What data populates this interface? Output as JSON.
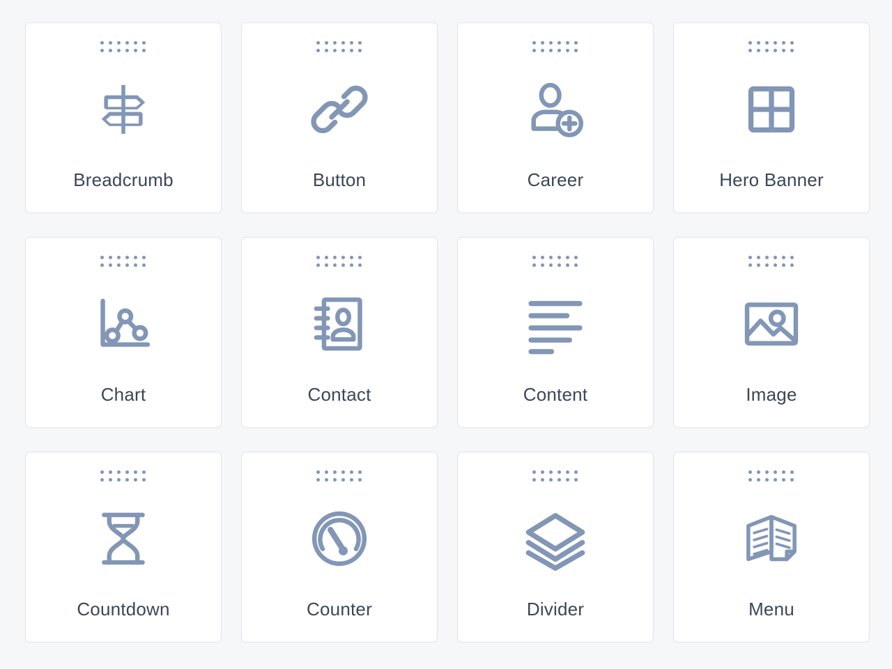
{
  "palette": {
    "drag_handle_dots": 12,
    "colors": {
      "background": "#f6f7f9",
      "card_background": "#ffffff",
      "card_border": "#dfe3ea",
      "icon": "#8296b6",
      "label_text": "#3b4657",
      "handle_dot": "#8296b6"
    },
    "widgets": [
      {
        "label": "Breadcrumb",
        "icon": "signpost-icon"
      },
      {
        "label": "Button",
        "icon": "link-chain-icon"
      },
      {
        "label": "Career",
        "icon": "user-plus-icon"
      },
      {
        "label": "Hero Banner",
        "icon": "grid-window-icon"
      },
      {
        "label": "Chart",
        "icon": "line-chart-icon"
      },
      {
        "label": "Contact",
        "icon": "address-book-icon"
      },
      {
        "label": "Content",
        "icon": "text-lines-icon"
      },
      {
        "label": "Image",
        "icon": "picture-icon"
      },
      {
        "label": "Countdown",
        "icon": "hourglass-icon"
      },
      {
        "label": "Counter",
        "icon": "speedometer-icon"
      },
      {
        "label": "Divider",
        "icon": "layers-icon"
      },
      {
        "label": "Menu",
        "icon": "open-book-icon"
      }
    ]
  }
}
